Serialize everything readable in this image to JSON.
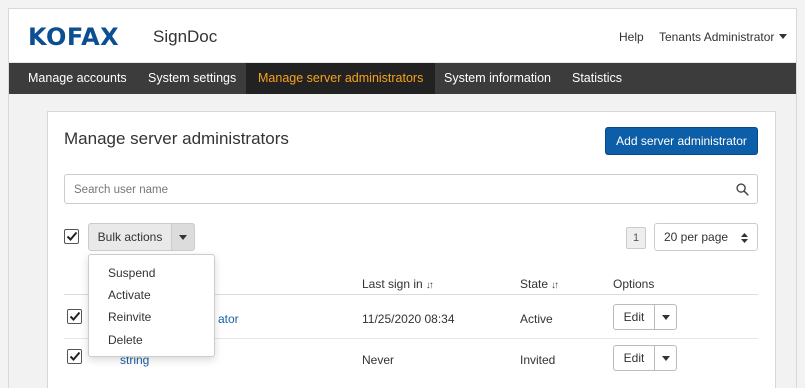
{
  "header": {
    "logo": "KOFAX",
    "product": "SignDoc",
    "help": "Help",
    "user_menu": "Tenants Administrator"
  },
  "nav": {
    "items": [
      "Manage accounts",
      "System settings",
      "Manage server administrators",
      "System information",
      "Statistics"
    ],
    "active": "Manage server administrators"
  },
  "colors": {
    "brand": "#0b4e92",
    "nav_bg": "#3c3c3c",
    "nav_active_text": "#f7a21c",
    "primary_button": "#0c5ea8"
  },
  "page": {
    "title": "Manage server administrators",
    "add_button": "Add server administrator",
    "search_placeholder": "Search user name",
    "bulk_actions": "Bulk actions",
    "pagination": {
      "current_page": "1",
      "per_page": "20 per page"
    },
    "bulk_menu": [
      "Suspend",
      "Activate",
      "Reinvite",
      "Delete"
    ]
  },
  "table": {
    "headers": [
      "Last sign in",
      "State",
      "Options"
    ],
    "rows": [
      {
        "name": "ator",
        "last_sign_in": "11/25/2020 08:34",
        "state": "Active",
        "action": "Edit",
        "checked": true
      },
      {
        "name": "string",
        "last_sign_in": "Never",
        "state": "Invited",
        "action": "Edit",
        "checked": true
      }
    ]
  }
}
